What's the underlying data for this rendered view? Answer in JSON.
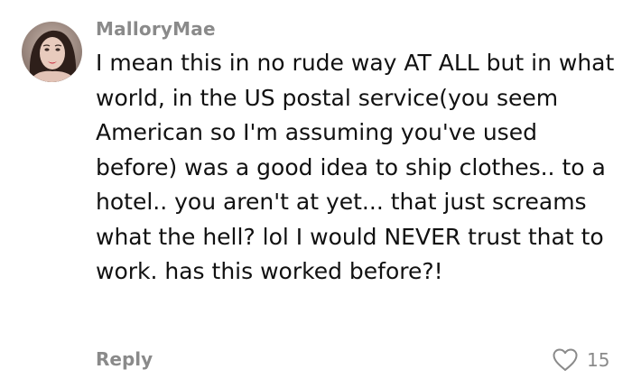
{
  "comment": {
    "author": "MalloryMae",
    "text": "I mean this in no rude way AT ALL but in what world, in the US postal service(you seem American so I'm assuming you've used before) was a good idea to ship clothes.. to a hotel.. you aren't at yet... that just screams what the hell? lol I would NEVER trust that to work. has this worked before?!",
    "reply_label": "Reply",
    "like_count": "15",
    "like_icon": "heart-outline-icon"
  },
  "colors": {
    "text": "#111111",
    "muted": "#8a8a8a",
    "background": "#ffffff"
  }
}
